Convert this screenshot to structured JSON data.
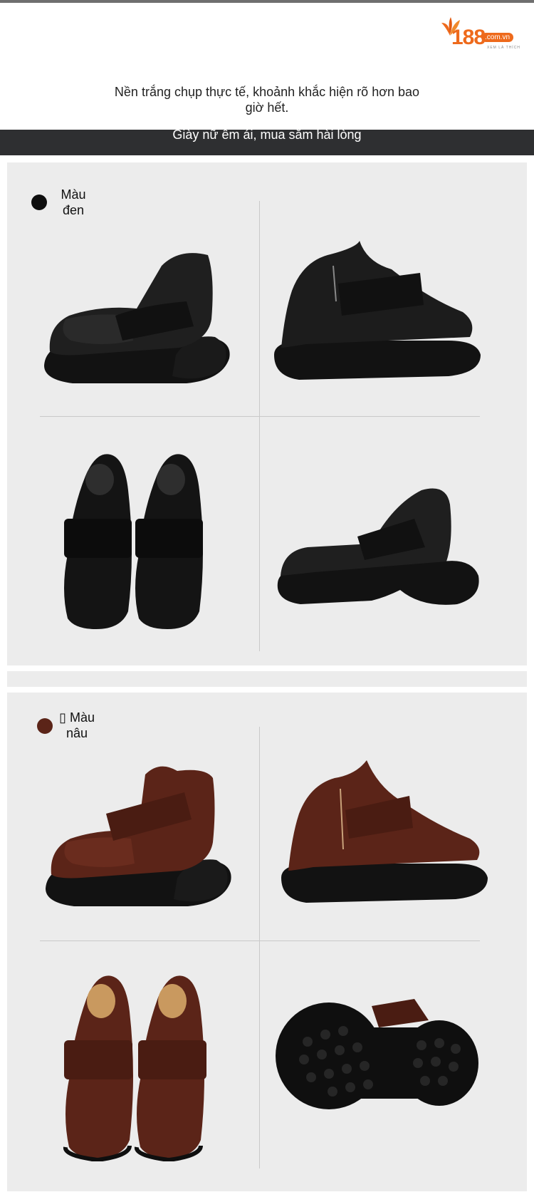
{
  "brand": {
    "logo_number": "188",
    "logo_domain": ".com.vn",
    "logo_tagline": "XEM LÀ THÍCH"
  },
  "hero": {
    "caption": "Nền trắng chụp thực tế, khoảnh khắc hiện rõ hơn bao giờ hết."
  },
  "band": {
    "text": "Giày nữ êm ái, mua sắm hài lòng"
  },
  "variants": [
    {
      "label": "Màu đen",
      "color": "#0e0e0e"
    },
    {
      "label": "Màu nâu",
      "prefix": "▯",
      "color": "#5b2418"
    }
  ],
  "colors": {
    "accent": "#ee6a1c",
    "band": "#2e2f31",
    "panel": "#ececec",
    "sole": "#121212"
  }
}
